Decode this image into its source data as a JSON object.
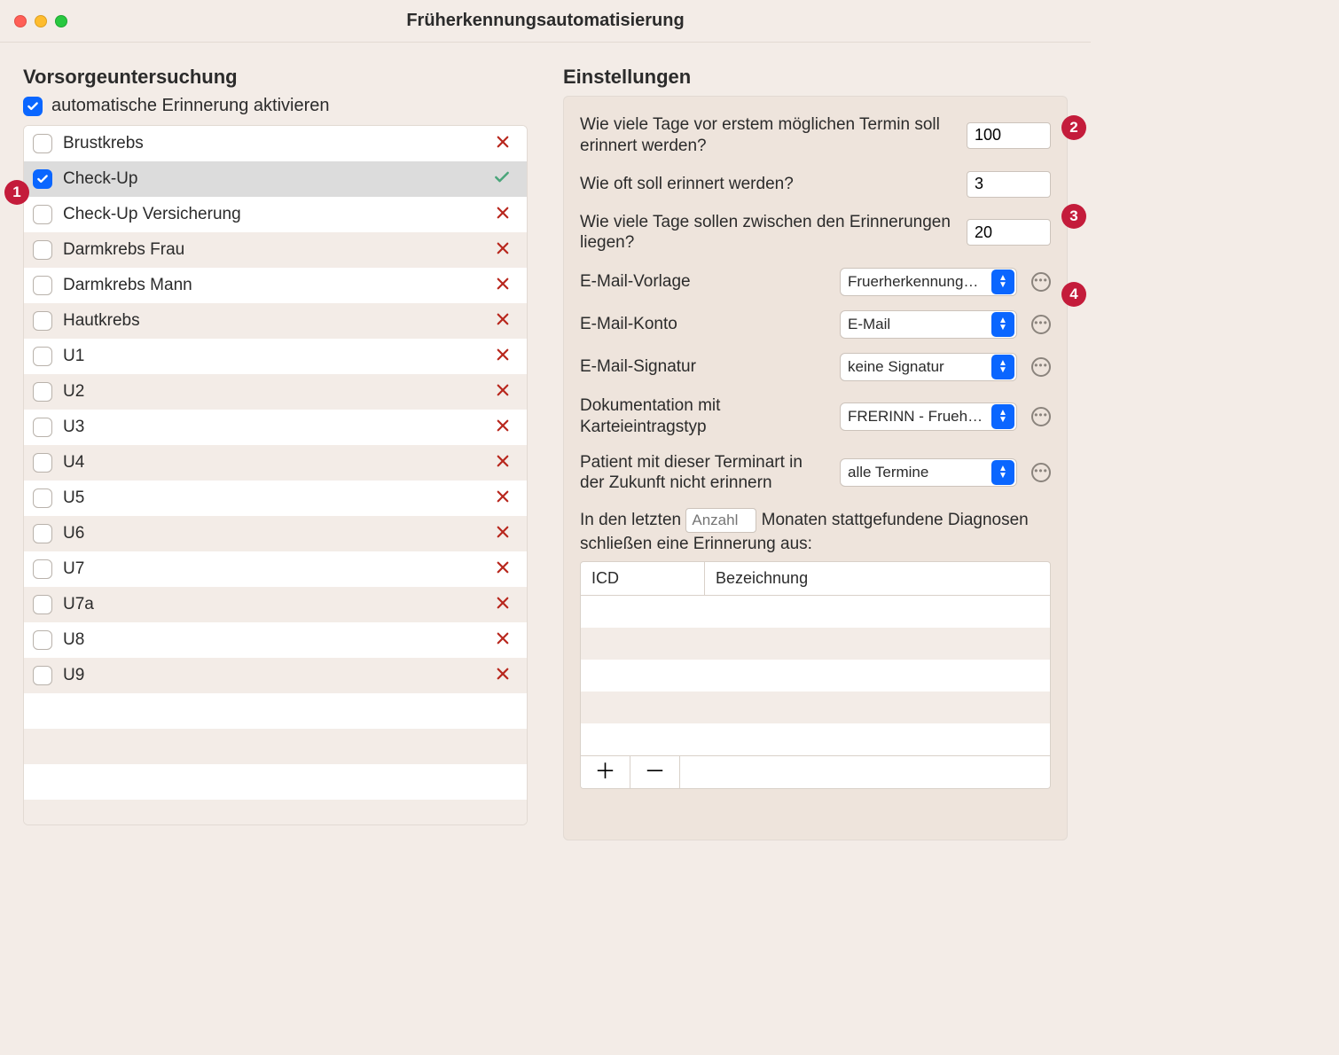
{
  "window_title": "Früherkennungsautomatisierung",
  "left": {
    "heading": "Vorsorgeuntersuchung",
    "master_checkbox_label": "automatische Erinnerung aktivieren",
    "master_checkbox_checked": true,
    "items": [
      {
        "label": "Brustkrebs",
        "checked": false,
        "status": "x",
        "selected": false
      },
      {
        "label": "Check-Up",
        "checked": true,
        "status": "check",
        "selected": true
      },
      {
        "label": "Check-Up Versicherung",
        "checked": false,
        "status": "x",
        "selected": false
      },
      {
        "label": "Darmkrebs Frau",
        "checked": false,
        "status": "x",
        "selected": false
      },
      {
        "label": "Darmkrebs Mann",
        "checked": false,
        "status": "x",
        "selected": false
      },
      {
        "label": "Hautkrebs",
        "checked": false,
        "status": "x",
        "selected": false
      },
      {
        "label": "U1",
        "checked": false,
        "status": "x",
        "selected": false
      },
      {
        "label": "U2",
        "checked": false,
        "status": "x",
        "selected": false
      },
      {
        "label": "U3",
        "checked": false,
        "status": "x",
        "selected": false
      },
      {
        "label": "U4",
        "checked": false,
        "status": "x",
        "selected": false
      },
      {
        "label": "U5",
        "checked": false,
        "status": "x",
        "selected": false
      },
      {
        "label": "U6",
        "checked": false,
        "status": "x",
        "selected": false
      },
      {
        "label": "U7",
        "checked": false,
        "status": "x",
        "selected": false
      },
      {
        "label": "U7a",
        "checked": false,
        "status": "x",
        "selected": false
      },
      {
        "label": "U8",
        "checked": false,
        "status": "x",
        "selected": false
      },
      {
        "label": "U9",
        "checked": false,
        "status": "x",
        "selected": false
      }
    ]
  },
  "right": {
    "heading": "Einstellungen",
    "q_days_before": "Wie viele Tage vor erstem möglichen Termin soll erinnert werden?",
    "v_days_before": "100",
    "q_how_often": "Wie oft soll erinnert werden?",
    "v_how_often": "3",
    "q_days_between": "Wie viele Tage sollen zwischen den Erinnerungen liegen?",
    "v_days_between": "20",
    "label_email_template": "E-Mail-Vorlage",
    "v_email_template": "Fruerherkennung…",
    "label_email_account": "E-Mail-Konto",
    "v_email_account": "E-Mail",
    "label_email_signature": "E-Mail-Signatur",
    "v_email_signature": "keine Signatur",
    "label_doc_type": "Dokumentation mit Karteieintragstyp",
    "v_doc_type": "FRERINN - Frueh…",
    "label_skip_appt": "Patient mit dieser Terminart in der Zukunft nicht erinnern",
    "v_skip_appt": "alle Termine",
    "sentence_pre": "In den letzten",
    "sentence_placeholder": "Anzahl",
    "sentence_post": "Monaten stattgefundene Diagnosen schließen eine Erinnerung aus:",
    "table": {
      "col_icd": "ICD",
      "col_name": "Bezeichnung"
    }
  },
  "callouts": [
    "1",
    "2",
    "3",
    "4"
  ]
}
